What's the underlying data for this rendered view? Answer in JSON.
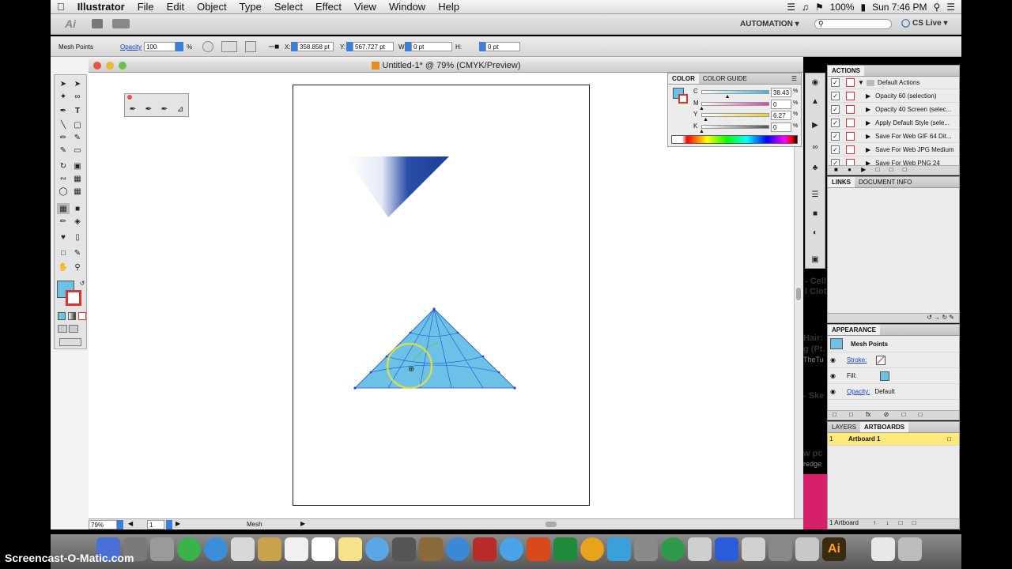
{
  "menubar": {
    "app": "Illustrator",
    "items": [
      "File",
      "Edit",
      "Object",
      "Type",
      "Select",
      "Effect",
      "View",
      "Window",
      "Help"
    ],
    "battery": "100%",
    "clock": "Sun 7:46 PM"
  },
  "appbar": {
    "logo": "Ai",
    "workspace": "AUTOMATION",
    "cslive": "CS Live"
  },
  "control": {
    "mode": "Mesh Points",
    "opacity_label": "Opacity",
    "opacity_value": "100",
    "percent": "%",
    "x_label": "X:",
    "x_value": "358.858 pt",
    "y_label": "Y:",
    "y_value": "567.727 pt",
    "w_label": "W:",
    "w_value": "0 pt",
    "h_label": "H:",
    "h_value": "0 pt"
  },
  "document": {
    "tab_title": "Untitled-1* @ 79% (CMYK/Preview)"
  },
  "status": {
    "zoom": "79%",
    "page": "1",
    "tool": "Mesh"
  },
  "color_panel": {
    "tabs": [
      "COLOR",
      "COLOR GUIDE"
    ],
    "channels": [
      {
        "label": "C",
        "value": "38.43",
        "level": 0.38
      },
      {
        "label": "M",
        "value": "0",
        "level": 0.0
      },
      {
        "label": "Y",
        "value": "6.27",
        "level": 0.06
      },
      {
        "label": "K",
        "value": "0",
        "level": 0.0
      }
    ],
    "unit": "%"
  },
  "actions_panel": {
    "title": "ACTIONS",
    "set": "Default Actions",
    "items": [
      "Opacity 60 (selection)",
      "Opacity 40 Screen (selec...",
      "Apply Default Style (sele...",
      "Save For Web GIF 64 Dit...",
      "Save For Web JPG Medium",
      "Save For Web PNG 24"
    ]
  },
  "links_panel": {
    "tabs": [
      "LINKS",
      "DOCUMENT INFO"
    ]
  },
  "appearance_panel": {
    "title": "APPEARANCE",
    "object": "Mesh Points",
    "stroke": "Stroke:",
    "fill": "Fill:",
    "opacity": "Opacity:",
    "opacity_value": "Default"
  },
  "artboards_panel": {
    "tabs": [
      "LAYERS",
      "ARTBOARDS"
    ],
    "rows": [
      {
        "num": "1",
        "name": "Artboard 1"
      }
    ],
    "footer": "1 Artboard"
  },
  "background_text": {
    "a": "- Cell",
    "b": "l Clot",
    "c": "Hair:",
    "d": "g (Pt.",
    "e": "TheTu",
    "f": "- Ske",
    "g": "w pc",
    "h": "redge"
  },
  "watermark": "Screencast-O-Matic.com",
  "colors": {
    "mesh_fill": "#6cc1e6",
    "mesh_lines": "#1f4bd8",
    "gradient_blue": "#1c3f9a",
    "highlight_circle": "#e8e23a",
    "artboard_selected": "#fde97a"
  }
}
